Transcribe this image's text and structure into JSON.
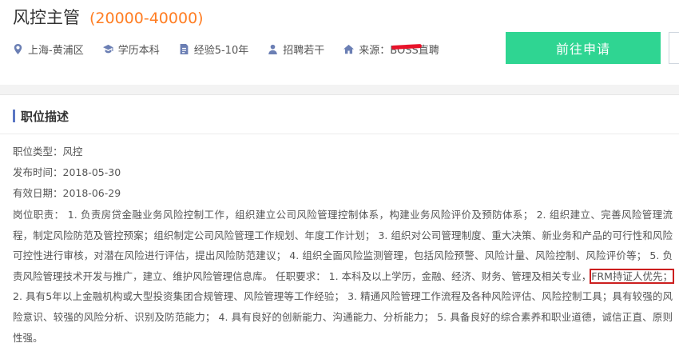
{
  "job": {
    "title": "风控主管",
    "salary": "(20000-40000)"
  },
  "meta": {
    "location": "上海-黄浦区",
    "education": "学历本科",
    "experience": "经验5-10年",
    "headcount": "招聘若干",
    "source_label": "来源：",
    "source_value": "BOSS直聘"
  },
  "actions": {
    "apply_label": "前往申请"
  },
  "description": {
    "section_title": "职位描述",
    "type": "职位类型：风控",
    "published": "发布时间：2018-05-30",
    "valid_until": "有效日期：2018-06-29",
    "duty_before": "岗位职责： 1. 负责房贷金融业务风险控制工作，组织建立公司风险管理控制体系，构建业务风险评价及预防体系； 2. 组织建立、完善风险管理流程，制定风险防范及管控预案；组织制定公司风险管理工作规划、年度工作计划； 3. 组织对公司管理制度、重大决策、新业务和产品的可行性和风险可控性进行审核，对潜在风险进行评估，提出风险防范建议； 4. 组织全面风险监测管理，包括风险预警、风险计量、风险控制、风险评价等； 5. 负责风险管理技术开发与推广，建立、维护风险管理信息库。 任职要求： 1. 本科及以上学历，金融、经济、财务、管理及相关专业，",
    "duty_highlight": "FRM持证人优先；",
    "duty_after": " 2. 具有5年以上金融机构或大型投资集团合规管理、风险管理等工作经验； 3. 精通风险管理工作流程及各种风险评估、风险控制工具；具有较强的风险意识、较强的风险分析、识别及防范能力； 4. 具有良好的创新能力、沟通能力、分析能力； 5. 具备良好的综合素养和职业道德，诚信正直、原则性强。"
  },
  "colors": {
    "salary": "#ff7e24",
    "apply": "#2fd592",
    "icon": "#6b7fb4",
    "highlight_border": "#cc1f1f"
  }
}
